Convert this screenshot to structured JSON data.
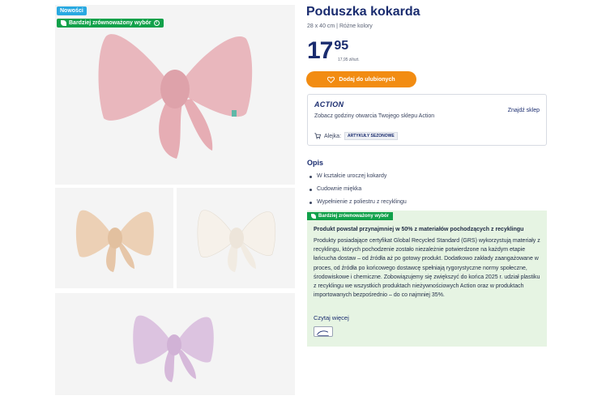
{
  "badges": {
    "new": "Nowości",
    "eco": "Bardziej zrównoważony wybór"
  },
  "product": {
    "title": "Poduszka kokarda",
    "subtitle": "28 x 40 cm | Różne kolory",
    "price_main": "17",
    "price_decimal": "95",
    "price_unit": "17,95 zł/szt."
  },
  "favorite_button": {
    "label": "Dodaj do ulubionych"
  },
  "store": {
    "logo": "ACTION",
    "text": "Zobacz godziny otwarcia Twojego sklepu Action",
    "find_link": "Znajdź sklep",
    "aisle_label": "Alejka:",
    "aisle_value": "ARTYKUŁY SEZONOWE"
  },
  "description": {
    "heading": "Opis",
    "items": [
      "W kształcie uroczej kokardy",
      "Cudownie miękka",
      "Wypełnienie z poliestru z recyklingu"
    ]
  },
  "eco_section": {
    "tag": "Bardziej zrównoważony wybór",
    "title": "Produkt powstał przynajmniej w 50% z materiałów pochodzących z recyklingu",
    "body": "Produkty posiadające certyfikat Global Recycled Standard (GRS) wykorzystują materiały z recyklingu, których pochodzenie zostało niezależnie potwierdzone na każdym etapie łańcucha dostaw – od źródła aż po gotowy produkt. Dodatkowo zakłady zaangażowane w proces, od źródła po końcowego dostawcę spełniają rygorystyczne normy społeczne, środowiskowe i chemiczne. Zobowiązujemy się zwiększyć do końca 2025 r. udział plastiku z recyklingu we wszystkich produktach nieżywnościowych Action oraz w produktach importowanych bezpośrednio – do co najmniej 35%.",
    "link": "Czytaj więcej"
  },
  "colors": {
    "brand": "#1a2c6f",
    "accent": "#f28c12",
    "eco_green": "#11a14a",
    "eco_bg": "#e6f4e3",
    "pink": "#e9b7bd",
    "beige": "#ecd0b5",
    "cream": "#f6f1ea",
    "lilac": "#dcc3e0"
  }
}
